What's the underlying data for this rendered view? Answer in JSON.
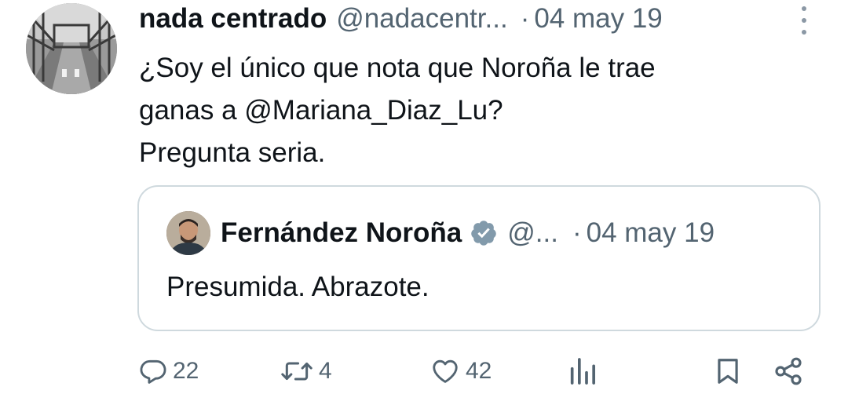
{
  "tweet": {
    "author_name": "nada centrado",
    "author_handle": "@nadacentr...",
    "separator": "·",
    "date": "04 may 19",
    "text_lines": [
      "¿Soy el único que nota que Noroña le trae",
      "ganas a @Mariana_Diaz_Lu?",
      "Pregunta seria."
    ],
    "more_icon": "more-vertical-icon"
  },
  "quoted_tweet": {
    "author_name": "Fernández Noroña",
    "verified_icon": "verified-badge-icon",
    "author_handle": "@...",
    "separator": "·",
    "date": "04 may 19",
    "text": "Presumida. Abrazote."
  },
  "actions": {
    "reply": {
      "icon": "reply-icon",
      "count": "22"
    },
    "retweet": {
      "icon": "retweet-icon",
      "count": "4"
    },
    "like": {
      "icon": "heart-icon",
      "count": "42"
    },
    "views": {
      "icon": "views-icon"
    },
    "bookmark": {
      "icon": "bookmark-icon"
    },
    "share": {
      "icon": "share-icon"
    }
  },
  "colors": {
    "text_primary": "#0f1419",
    "text_secondary": "#536471",
    "border": "#cfd9de",
    "verified_badge": "#829aab"
  }
}
